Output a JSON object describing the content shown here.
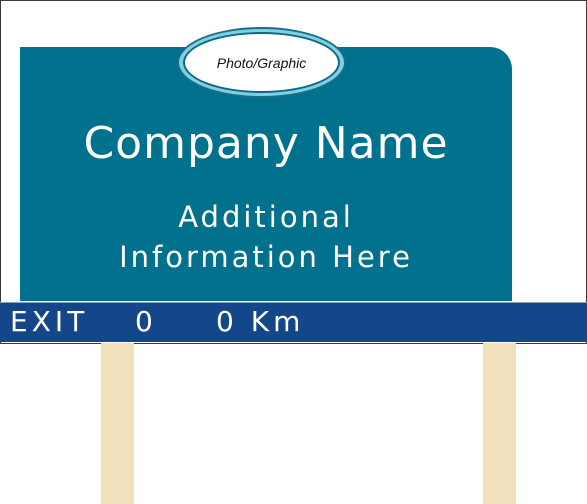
{
  "sign": {
    "photo_label": "Photo/Graphic",
    "company_name": "Company Name",
    "info_line_1": "Additional",
    "info_line_2": "Information Here"
  },
  "exit_bar": {
    "label": "EXIT",
    "number": "0",
    "distance": "0 Km"
  },
  "colors": {
    "panel": "#02718d",
    "exit_bar": "#14478a",
    "oval_ring": "#7fd0e4",
    "posts": "#f1e0bb"
  }
}
